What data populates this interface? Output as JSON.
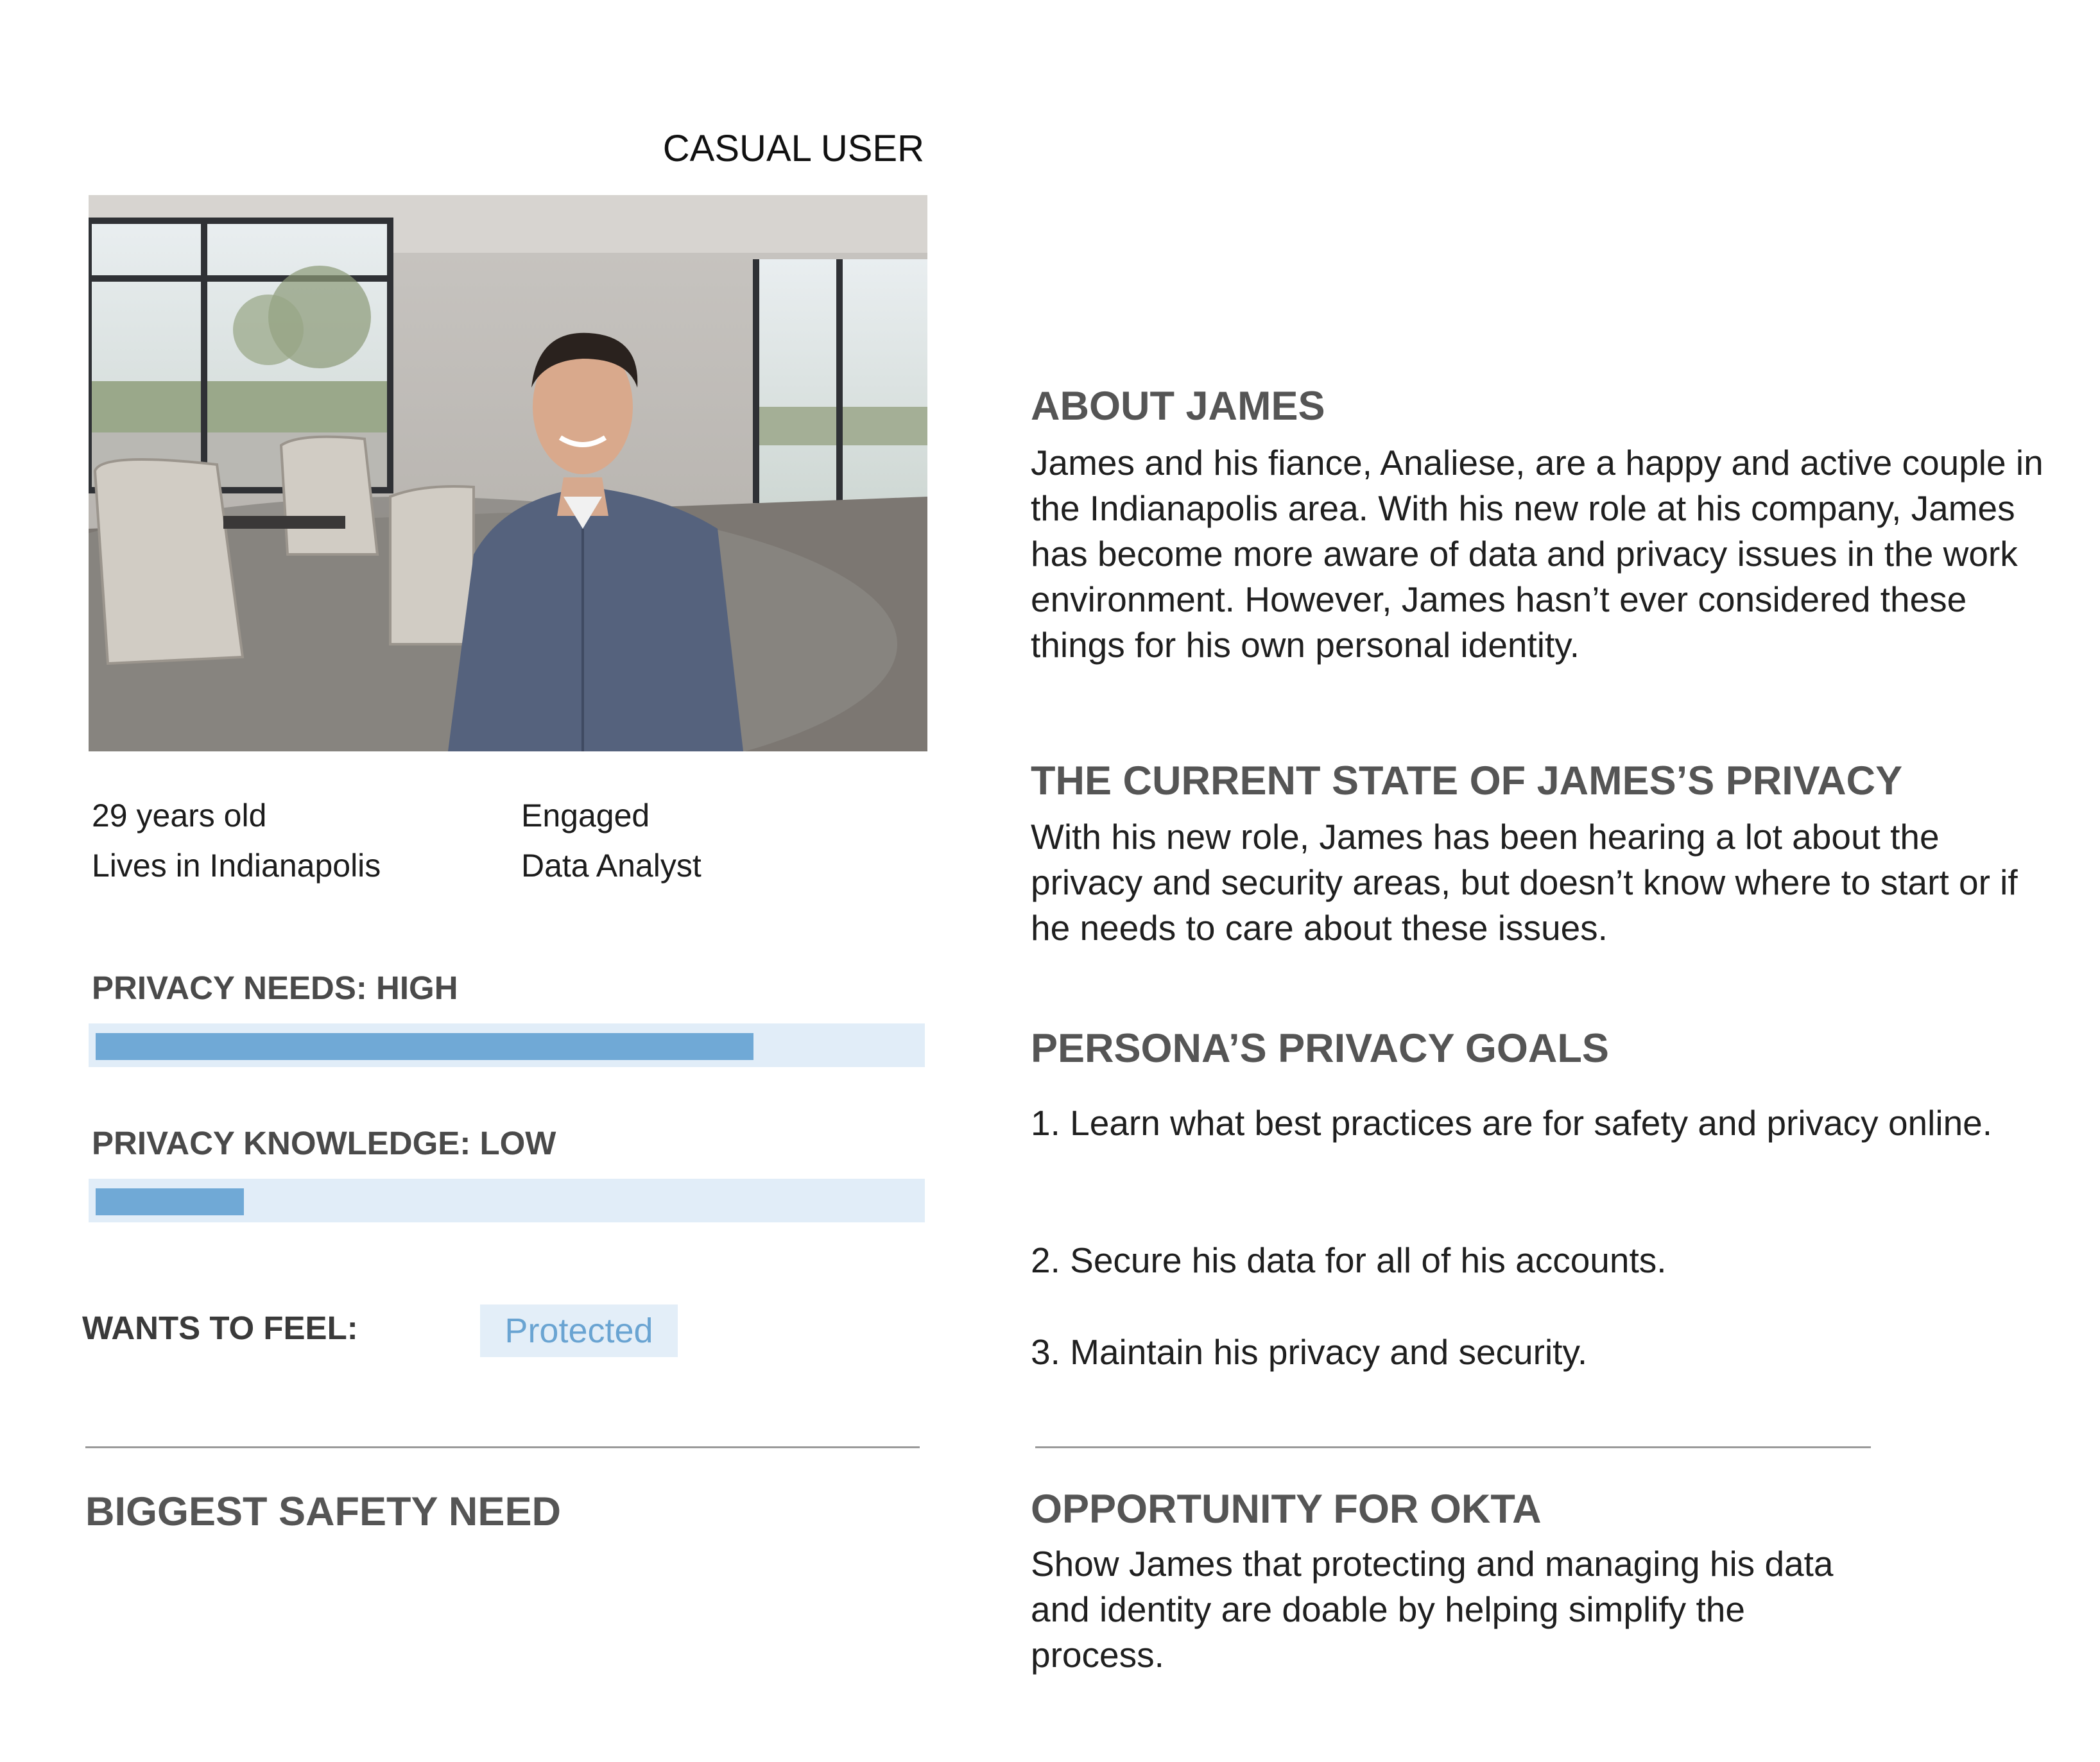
{
  "persona_type": "CASUAL USER",
  "facts": {
    "age": "29 years old",
    "location": "Lives in Indianapolis",
    "status": "Engaged",
    "job": "Data Analyst"
  },
  "meters": {
    "needs": {
      "label": "PRIVACY NEEDS: HIGH",
      "level": 0.8
    },
    "knowledge": {
      "label": "PRIVACY KNOWLEDGE: LOW",
      "level": 0.18
    }
  },
  "feel": {
    "label": "WANTS TO FEEL:",
    "value": "Protected"
  },
  "biggest_safety_need": {
    "title": "BIGGEST SAFETY NEED"
  },
  "about": {
    "title": "ABOUT JAMES",
    "text": "James and his fiance, Analiese, are a happy and active couple in the Indianapolis area. With his new role at his company, James has become more aware of data and privacy issues in the work environment. However, James hasn’t ever considered these things for his own personal identity."
  },
  "current_state": {
    "title": "THE CURRENT STATE OF JAMES’S PRIVACY",
    "text": "With his new role, James has been hearing a lot about the privacy and security areas, but doesn’t know where to start or if he needs to care about these issues."
  },
  "goals": {
    "title": "PERSONA’S PRIVACY GOALS",
    "items": [
      "1.  Learn what best practices are for safety and privacy online.",
      "2.  Secure his data for all of his accounts.",
      "3.  Maintain his privacy and security."
    ]
  },
  "opportunity": {
    "title": "OPPORTUNITY FOR OKTA",
    "text": "Show James that protecting and managing his data and identity are doable by helping simplify the process."
  },
  "colors": {
    "meter_fill": "#70a9d6",
    "meter_track": "#e1edf8",
    "chip_text": "#6aa4d2",
    "heading": "#555555"
  }
}
